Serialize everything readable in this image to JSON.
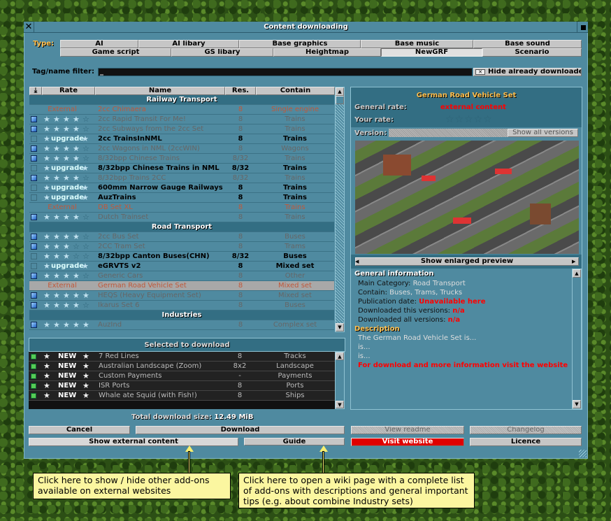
{
  "window": {
    "title": "Content downloading"
  },
  "type_filter": {
    "label": "Type:",
    "row1": [
      "AI",
      "AI libary",
      "Base graphics",
      "Base music",
      "Base sound"
    ],
    "row2": [
      "Game script",
      "GS libary",
      "Heightmap",
      "NewGRF",
      "Scenario"
    ],
    "selected": "NewGRF"
  },
  "tag_filter": {
    "label": "Tag/name filter:",
    "value": "_",
    "hide_downloaded": "Hide already downloaded"
  },
  "list": {
    "headers": {
      "rate": "Rate",
      "name": "Name",
      "res": "Res.",
      "contain": "Contain"
    },
    "rows": [
      {
        "section": "Railway Transport"
      },
      {
        "status": "external",
        "rate": "External",
        "name": "2cc Chimaera",
        "res": "8",
        "contain": "Single engine"
      },
      {
        "status": "installed",
        "stars": 4,
        "name": "2cc Rapid Transit For Me!",
        "res": "8",
        "contain": "Trains"
      },
      {
        "status": "installed",
        "stars": 4,
        "name": "2cc Subways from the 2cc Set",
        "res": "8",
        "contain": "Trains"
      },
      {
        "status": "upgrade",
        "rate": "upgrade",
        "name": "2cc TrainsInNML",
        "res": "8",
        "contain": "Trains"
      },
      {
        "status": "installed",
        "stars": 4.5,
        "name": "2cc Wagons in NML (2ccWIN)",
        "res": "8",
        "contain": "Wagons"
      },
      {
        "status": "installed",
        "stars": 4,
        "name": "8/32bpp Chinese Trains",
        "res": "8/32",
        "contain": "Trains"
      },
      {
        "status": "upgrade",
        "rate": "upgrade",
        "name": "8/32bpp Chinese Trains in NML",
        "res": "8/32",
        "contain": "Trains"
      },
      {
        "status": "installed",
        "stars": 4,
        "name": "8/32bpp Trains 2CC",
        "res": "8/32",
        "contain": "Trains"
      },
      {
        "status": "upgrade",
        "rate": "upgrade",
        "name": "600mm Narrow Gauge Railways",
        "res": "8",
        "contain": "Trains"
      },
      {
        "status": "upgrade",
        "rate": "upgrade",
        "name": "AuzTrains",
        "res": "8",
        "contain": "Trains"
      },
      {
        "status": "external",
        "rate": "External",
        "name": "DB Set XL",
        "res": "8",
        "contain": "Trains"
      },
      {
        "status": "installed",
        "stars": 4.5,
        "name": "Dutch Trainset",
        "res": "8",
        "contain": "Trains"
      },
      {
        "section": "Road Transport"
      },
      {
        "status": "installed",
        "stars": 4,
        "name": "2cc Bus Set",
        "res": "8",
        "contain": "Buses"
      },
      {
        "status": "installed",
        "stars": 3.5,
        "name": "2CC Tram Set",
        "res": "8",
        "contain": "Trams"
      },
      {
        "status": "available",
        "stars": 3.5,
        "name": "8/32bpp Canton Buses(CHN)",
        "res": "8/32",
        "contain": "Buses"
      },
      {
        "status": "upgrade",
        "rate": "upgrade",
        "name": "eGRVTS v2",
        "res": "8",
        "contain": "Mixed set"
      },
      {
        "status": "installed",
        "stars": 4,
        "name": "Generic Cars",
        "res": "8",
        "contain": "Other"
      },
      {
        "status": "external",
        "selected": true,
        "rate": "External",
        "name": "German Road Vehicle Set",
        "res": "8",
        "contain": "Mixed set"
      },
      {
        "status": "installed",
        "stars": 5,
        "name": "HEQS (Heavy Equipment Set)",
        "res": "8",
        "contain": "Mixed set"
      },
      {
        "status": "installed",
        "stars": 4.5,
        "name": "Ikarus Set 6",
        "res": "8",
        "contain": "Buses"
      },
      {
        "section": "Industries"
      },
      {
        "status": "installed",
        "stars": 5,
        "name": "AuzInd",
        "res": "8",
        "contain": "Complex set"
      }
    ]
  },
  "selected": {
    "title": "Selected to download",
    "rows": [
      {
        "rate": "NEW",
        "name": "7 Red Lines",
        "res": "8",
        "contain": "Tracks"
      },
      {
        "rate": "NEW",
        "name": "Australian Landscape (Zoom)",
        "res": "8x2",
        "contain": "Landscape"
      },
      {
        "rate": "NEW",
        "name": "Custom Payments",
        "res": "-",
        "contain": "Payments"
      },
      {
        "rate": "NEW",
        "name": "ISR Ports",
        "res": "8",
        "contain": "Ports"
      },
      {
        "rate": "NEW",
        "name": "Whale ate Squid (with Fish!)",
        "res": "8",
        "contain": "Ships"
      }
    ],
    "total_label": "Total download size:",
    "total": "12.49 MiB"
  },
  "details": {
    "title": "German Road Vehicle Set",
    "general_rate_label": "General rate:",
    "general_rate": "external content",
    "your_rate_label": "Your rate:",
    "your_rate": 0,
    "version_label": "Version:",
    "show_all_versions": "Show all versions",
    "show_preview": "Show enlarged preview",
    "info_heading": "General information",
    "info": [
      {
        "k": "Main Category:",
        "v": "Road Transport",
        "red": false
      },
      {
        "k": "Contain:",
        "v": "Buses, Trams, Trucks",
        "red": false
      },
      {
        "k": "Publication date:",
        "v": "Unavailable here",
        "red": true
      },
      {
        "k": "Downloaded this versions:",
        "v": "n/a",
        "red": true
      },
      {
        "k": "Downloaded all versions:",
        "v": "n/a",
        "red": true
      }
    ],
    "desc_heading": "Description",
    "desc": [
      "The German Road Vehicle Set is...",
      "is...",
      "is..."
    ],
    "desc_link": "For download and more information visit the website"
  },
  "buttons": {
    "cancel": "Cancel",
    "download": "Download",
    "show_external": "Show external content",
    "guide": "Guide",
    "view_readme": "View readme",
    "changelog": "Changelog",
    "visit_website": "Visit website",
    "licence": "Licence"
  },
  "tooltips": {
    "external": "Click here to show / hide other add-ons available on external websites",
    "guide": "Click here to open a wiki page with a complete list of add-ons with descriptions and general important tips (e.g. about combine Industry sets)"
  },
  "colors": {
    "window": "#4f8aa0",
    "external": "#c0583a",
    "installed": "#666666",
    "visit_website": "#e00000",
    "accent": "#ffc050"
  }
}
